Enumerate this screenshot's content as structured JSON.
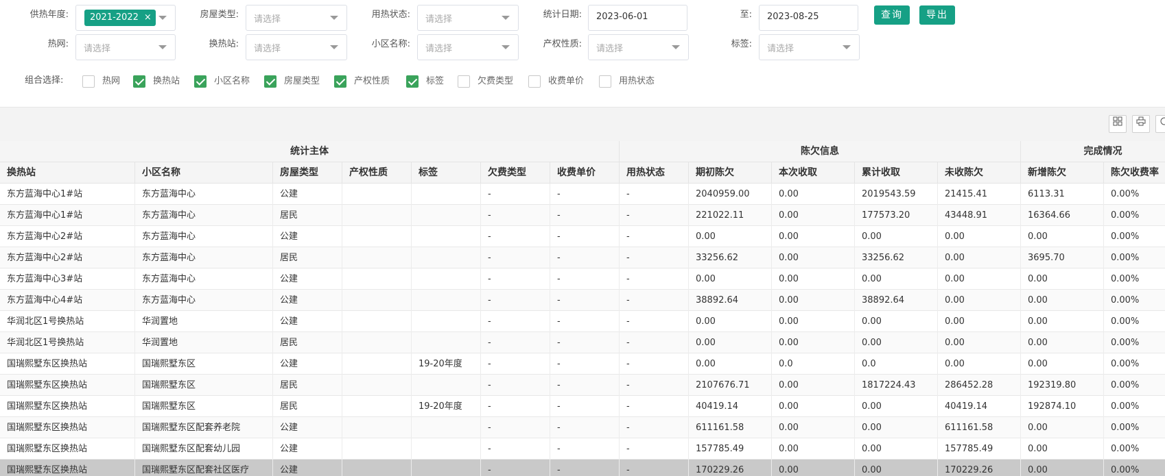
{
  "filters": {
    "row1": {
      "year_label": "供热年度:",
      "year_tag": "2021-2022",
      "year_tag_close": "×",
      "house_type_label": "房屋类型:",
      "house_type_placeholder": "请选择",
      "heat_status_label": "用热状态:",
      "heat_status_placeholder": "请选择",
      "date_label": "统计日期:",
      "date_from": "2023-06-01",
      "to_label": "至:",
      "date_to": "2023-08-25"
    },
    "row2": {
      "network_label": "热网:",
      "network_placeholder": "请选择",
      "station_label": "换热站:",
      "station_placeholder": "请选择",
      "community_label": "小区名称:",
      "community_placeholder": "请选择",
      "property_label": "产权性质:",
      "property_placeholder": "请选择",
      "tag_label": "标签:",
      "tag_placeholder": "请选择"
    },
    "query_button": "查询",
    "export_button": "导出"
  },
  "combo": {
    "label": "组合选择:",
    "options": [
      {
        "label": "热网",
        "checked": false
      },
      {
        "label": "换热站",
        "checked": true
      },
      {
        "label": "小区名称",
        "checked": true
      },
      {
        "label": "房屋类型",
        "checked": true
      },
      {
        "label": "产权性质",
        "checked": true
      },
      {
        "label": "标签",
        "checked": true
      },
      {
        "label": "欠费类型",
        "checked": false
      },
      {
        "label": "收费单价",
        "checked": false
      },
      {
        "label": "用热状态",
        "checked": false
      }
    ]
  },
  "toolbar": {
    "columns_icon": "grid-columns-icon",
    "print_icon": "print-icon",
    "export_icon": "export-icon"
  },
  "table": {
    "groups": {
      "subject": "统计主体",
      "arrears": "陈欠信息",
      "completion": "完成情况"
    },
    "headers": [
      "换热站",
      "小区名称",
      "房屋类型",
      "产权性质",
      "标签",
      "欠费类型",
      "收费单价",
      "用热状态",
      "期初陈欠",
      "本次收取",
      "累计收取",
      "未收陈欠",
      "新增陈欠",
      "陈欠收费率"
    ],
    "rows": [
      [
        "东方蓝海中心1#站",
        "东方蓝海中心",
        "公建",
        "",
        "",
        "-",
        "-",
        "-",
        "2040959.00",
        "0.00",
        "2019543.59",
        "21415.41",
        "6113.31",
        "0.00%"
      ],
      [
        "东方蓝海中心1#站",
        "东方蓝海中心",
        "居民",
        "",
        "",
        "-",
        "-",
        "-",
        "221022.11",
        "0.00",
        "177573.20",
        "43448.91",
        "16364.66",
        "0.00%"
      ],
      [
        "东方蓝海中心2#站",
        "东方蓝海中心",
        "公建",
        "",
        "",
        "-",
        "-",
        "-",
        "0.00",
        "0.00",
        "0.00",
        "0.00",
        "0.00",
        "0.00%"
      ],
      [
        "东方蓝海中心2#站",
        "东方蓝海中心",
        "居民",
        "",
        "",
        "-",
        "-",
        "-",
        "33256.62",
        "0.00",
        "33256.62",
        "0.00",
        "3695.70",
        "0.00%"
      ],
      [
        "东方蓝海中心3#站",
        "东方蓝海中心",
        "公建",
        "",
        "",
        "-",
        "-",
        "-",
        "0.00",
        "0.00",
        "0.00",
        "0.00",
        "0.00",
        "0.00%"
      ],
      [
        "东方蓝海中心4#站",
        "东方蓝海中心",
        "公建",
        "",
        "",
        "-",
        "-",
        "-",
        "38892.64",
        "0.00",
        "38892.64",
        "0.00",
        "0.00",
        "0.00%"
      ],
      [
        "华润北区1号换热站",
        "华润置地",
        "公建",
        "",
        "",
        "-",
        "-",
        "-",
        "0.00",
        "0.00",
        "0.00",
        "0.00",
        "0.00",
        "0.00%"
      ],
      [
        "华润北区1号换热站",
        "华润置地",
        "居民",
        "",
        "",
        "-",
        "-",
        "-",
        "0.00",
        "0.00",
        "0.00",
        "0.00",
        "0.00",
        "0.00%"
      ],
      [
        "国瑞熙墅东区换热站",
        "国瑞熙墅东区",
        "公建",
        "",
        "19-20年度",
        "-",
        "-",
        "-",
        "0.00",
        "0.0",
        "0.0",
        "0.00",
        "0.00",
        "0.00%"
      ],
      [
        "国瑞熙墅东区换热站",
        "国瑞熙墅东区",
        "居民",
        "",
        "",
        "-",
        "-",
        "-",
        "2107676.71",
        "0.00",
        "1817224.43",
        "286452.28",
        "192319.80",
        "0.00%"
      ],
      [
        "国瑞熙墅东区换热站",
        "国瑞熙墅东区",
        "居民",
        "",
        "19-20年度",
        "-",
        "-",
        "-",
        "40419.14",
        "0.00",
        "0.00",
        "40419.14",
        "192874.10",
        "0.00%"
      ],
      [
        "国瑞熙墅东区换热站",
        "国瑞熙墅东区配套养老院",
        "公建",
        "",
        "",
        "-",
        "-",
        "-",
        "611161.58",
        "0.00",
        "0.00",
        "611161.58",
        "0.00",
        "0.00%"
      ],
      [
        "国瑞熙墅东区换热站",
        "国瑞熙墅东区配套幼儿园",
        "公建",
        "",
        "",
        "-",
        "-",
        "-",
        "157785.49",
        "0.00",
        "0.00",
        "157785.49",
        "0.00",
        "0.00%"
      ],
      [
        "国瑞熙墅东区换热站",
        "国瑞熙墅东区配套社区医疗",
        "公建",
        "",
        "",
        "-",
        "-",
        "-",
        "170229.26",
        "0.00",
        "0.00",
        "170229.26",
        "0.00",
        "0.00%"
      ]
    ],
    "selected_row": 13
  }
}
